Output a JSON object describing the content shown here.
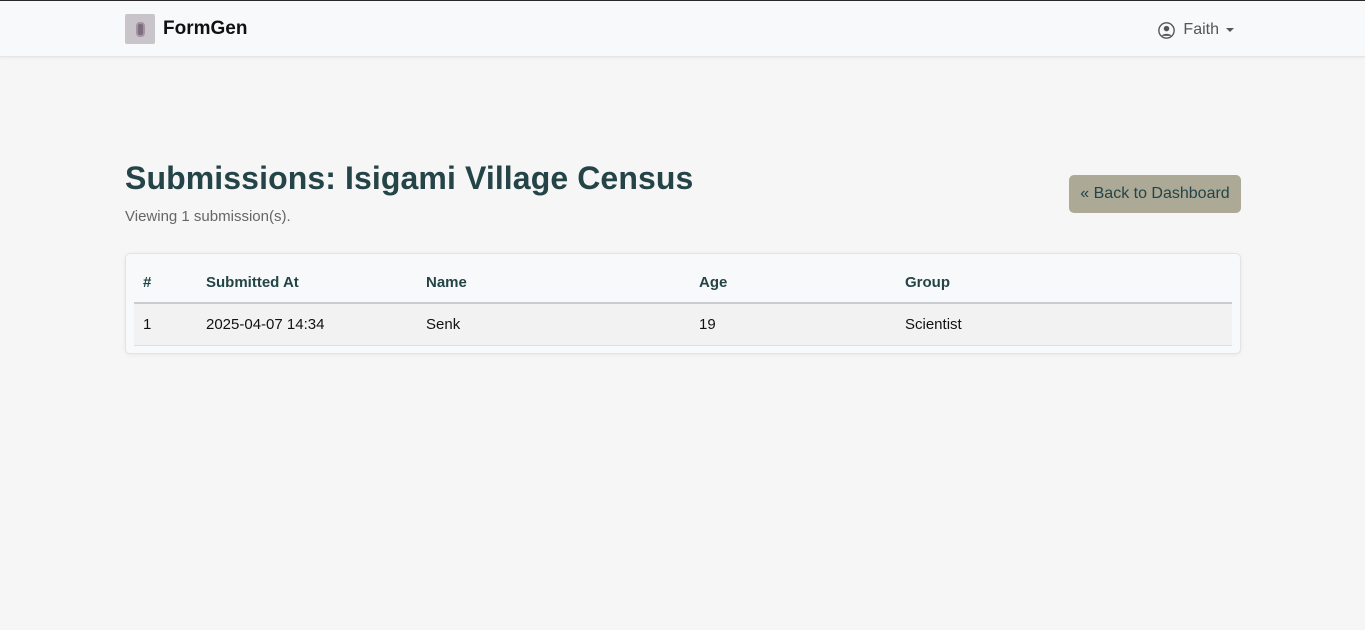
{
  "navbar": {
    "brand": "FormGen",
    "logo_icon": "form-logo-icon",
    "user": {
      "name": "Faith",
      "icon": "user-circle-icon"
    }
  },
  "page": {
    "title": "Submissions: Isigami Village Census",
    "subtitle": "Viewing 1 submission(s).",
    "back_button": "« Back to Dashboard"
  },
  "table": {
    "headers": [
      "#",
      "Submitted At",
      "Name",
      "Age",
      "Group"
    ],
    "rows": [
      [
        "1",
        "2025-04-07 14:34",
        "Senk",
        "19",
        "Scientist"
      ]
    ]
  },
  "colors": {
    "accent_button": "#aca996",
    "title_text": "#244447",
    "background": "#f6f6f6"
  }
}
